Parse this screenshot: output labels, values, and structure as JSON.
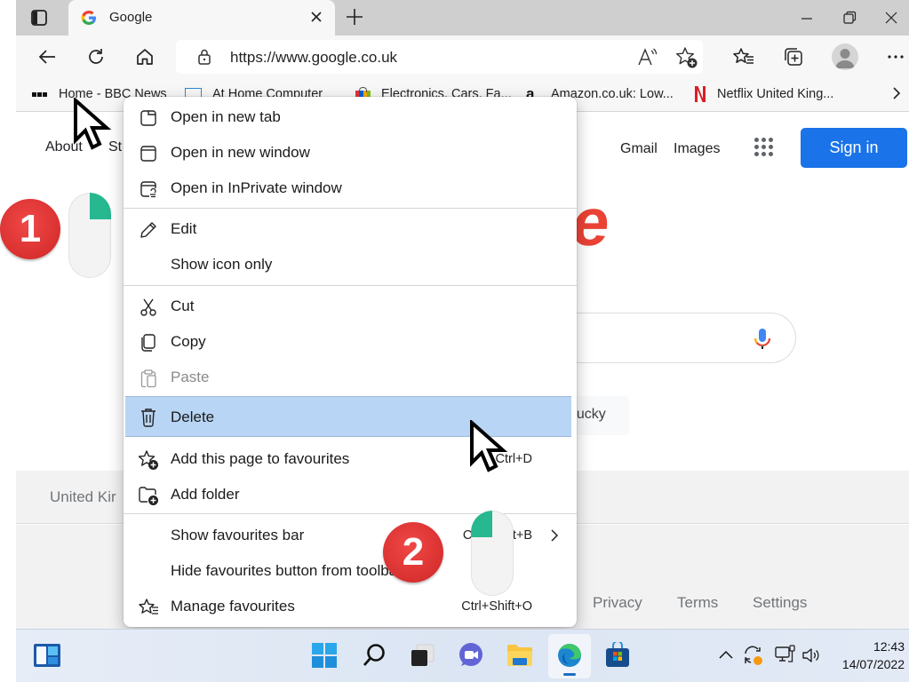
{
  "browser": {
    "tab": {
      "title": "Google",
      "favicon": "google-g-icon"
    },
    "address": {
      "url": "https://www.google.co.uk"
    },
    "toolbar_icons": [
      "back-icon",
      "refresh-icon",
      "home-icon",
      "lock-icon",
      "read-aloud-icon",
      "add-favourite-icon",
      "favourites-icon",
      "collections-icon",
      "profile-icon",
      "more-icon"
    ],
    "window_controls": [
      "minimize",
      "restore",
      "close"
    ]
  },
  "favourites_bar": {
    "items": [
      {
        "label": "Home - BBC News",
        "icon": "bbc-icon"
      },
      {
        "label": "At Home Computer",
        "icon": "monitor-icon"
      },
      {
        "label": "Electronics, Cars, Fa...",
        "icon": "ebay-bag-icon"
      },
      {
        "label": "Amazon.co.uk: Low...",
        "icon": "amazon-icon"
      },
      {
        "label": "Netflix United King...",
        "icon": "netflix-icon"
      }
    ],
    "overflow": "chevron-right-icon"
  },
  "google_page": {
    "header_left": [
      "About",
      "St"
    ],
    "header_right": {
      "gmail": "Gmail",
      "images": "Images",
      "sign_in": "Sign in"
    },
    "logo_visible_letter": "e",
    "lucky_button_partial": "Lucky",
    "footer_country": "United Kir",
    "footer_links": [
      "Privacy",
      "Terms",
      "Settings"
    ],
    "colors": {
      "sign_in": "#1a73e8",
      "logo_red": "#ea4335"
    }
  },
  "context_menu": {
    "groups": [
      [
        {
          "label": "Open in new tab",
          "icon": "new-tab-icon"
        },
        {
          "label": "Open in new window",
          "icon": "new-window-icon"
        },
        {
          "label": "Open in InPrivate window",
          "icon": "inprivate-icon"
        }
      ],
      [
        {
          "label": "Edit",
          "icon": "pencil-icon"
        },
        {
          "label": "Show icon only",
          "icon": ""
        }
      ],
      [
        {
          "label": "Cut",
          "icon": "scissors-icon"
        },
        {
          "label": "Copy",
          "icon": "copy-icon"
        },
        {
          "label": "Paste",
          "icon": "paste-icon",
          "disabled": true
        },
        {
          "label": "Delete",
          "icon": "trash-icon",
          "highlighted": true
        },
        {
          "label": "Add this page to favourites",
          "icon": "star-add-icon",
          "shortcut": "Ctrl+D"
        },
        {
          "label": "Add folder",
          "icon": "folder-add-icon"
        }
      ],
      [
        {
          "label": "Show favourites bar",
          "icon": "",
          "shortcut": "Ctrl+Shift+B",
          "submenu": true
        },
        {
          "label": "Hide favourites button from toolbar",
          "icon": ""
        },
        {
          "label": "Manage favourites",
          "icon": "star-list-icon",
          "shortcut": "Ctrl+Shift+O"
        }
      ]
    ],
    "highlight_color": "#b9d5f5"
  },
  "annotations": {
    "step1": "1",
    "step2": "2",
    "badge_color": "#e03a3a",
    "mouse_button_color": "#27b88f"
  },
  "taskbar": {
    "icons": [
      "widgets-icon",
      "start-icon",
      "search-icon",
      "task-view-icon",
      "teams-chat-icon",
      "file-explorer-icon",
      "edge-icon",
      "store-icon"
    ],
    "tray": [
      "chevron-up-icon",
      "sync-icon",
      "network-icon",
      "volume-icon"
    ],
    "time": "12:43",
    "date": "14/07/2022"
  }
}
